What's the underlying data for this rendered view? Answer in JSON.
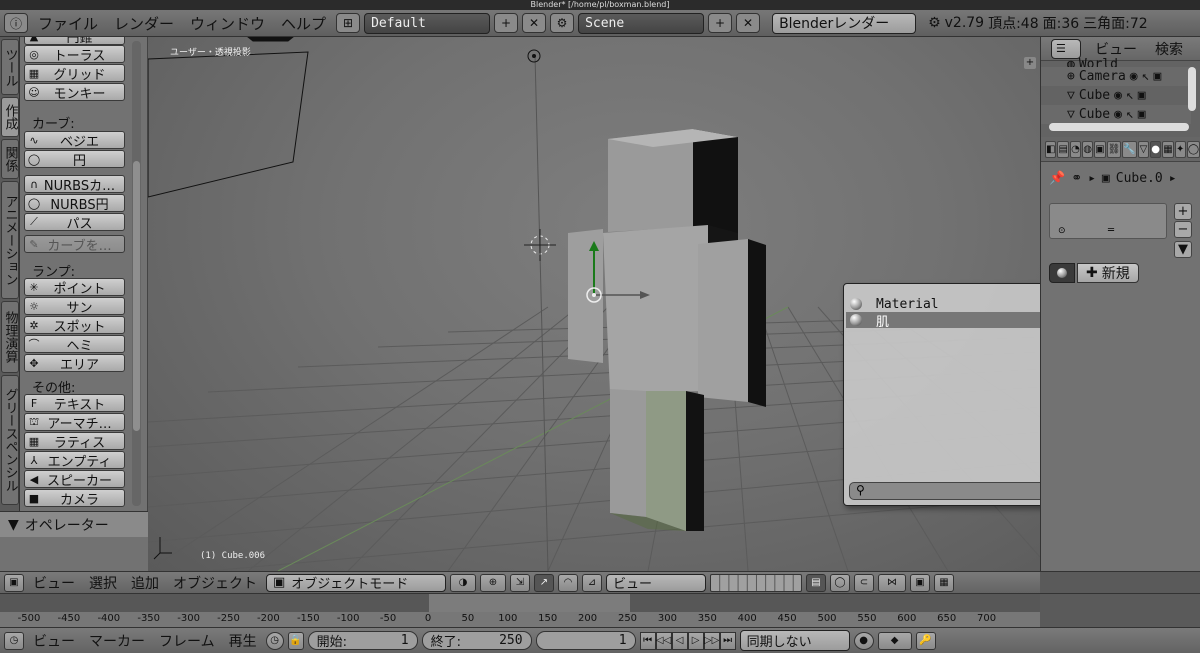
{
  "window_title": "Blender* [/home/pl/boxman.blend]",
  "info_header": {
    "menus": [
      "ファイル",
      "レンダー",
      "ウィンドウ",
      "ヘルプ"
    ],
    "screen_layout": "Default",
    "scene": "Scene",
    "render_engine": "Blenderレンダー",
    "version": "v2.79",
    "verts": "頂点:48",
    "faces": "面:36",
    "tris": "三角面:72"
  },
  "tool_tabs": [
    "ツール",
    "作成",
    "関係",
    "アニメーション",
    "物理演算",
    "グリースペンシル"
  ],
  "toolshelf": {
    "top_partial": "円錐",
    "items_top": [
      {
        "icon": "torus-icon",
        "glyph": "◎",
        "label": "トーラス"
      },
      {
        "icon": "grid-icon",
        "glyph": "▦",
        "label": "グリッド"
      },
      {
        "icon": "monkey-icon",
        "glyph": "☺",
        "label": "モンキー"
      }
    ],
    "curve_heading": "カーブ:",
    "curve_items": [
      {
        "icon": "bezier-icon",
        "glyph": "∿",
        "label": "ベジエ"
      },
      {
        "icon": "circle-icon",
        "glyph": "◯",
        "label": "円"
      }
    ],
    "nurbs_items": [
      {
        "icon": "nurbs-curve-icon",
        "glyph": "∩",
        "label": "NURBSカ…"
      },
      {
        "icon": "nurbs-circle-icon",
        "glyph": "◯",
        "label": "NURBS円"
      },
      {
        "icon": "path-icon",
        "glyph": "⟋",
        "label": "パス"
      }
    ],
    "curve_draw": {
      "icon": "curve-draw-icon",
      "glyph": "✎",
      "label": "カーブを…"
    },
    "lamp_heading": "ランプ:",
    "lamp_items": [
      {
        "icon": "point-lamp-icon",
        "glyph": "✳",
        "label": "ポイント"
      },
      {
        "icon": "sun-lamp-icon",
        "glyph": "☼",
        "label": "サン"
      },
      {
        "icon": "spot-lamp-icon",
        "glyph": "✲",
        "label": "スポット"
      },
      {
        "icon": "hemi-lamp-icon",
        "glyph": "⌒",
        "label": "ヘミ"
      },
      {
        "icon": "area-lamp-icon",
        "glyph": "✥",
        "label": "エリア"
      }
    ],
    "other_heading": "その他:",
    "other_items": [
      {
        "icon": "text-icon",
        "glyph": "F",
        "label": "テキスト"
      },
      {
        "icon": "armature-icon",
        "glyph": "⛫",
        "label": "アーマチ…"
      },
      {
        "icon": "lattice-icon",
        "glyph": "▦",
        "label": "ラティス"
      },
      {
        "icon": "empty-icon",
        "glyph": "⅄",
        "label": "エンプティ"
      },
      {
        "icon": "speaker-icon",
        "glyph": "◀",
        "label": "スピーカー"
      },
      {
        "icon": "camera-icon",
        "glyph": "■",
        "label": "カメラ"
      }
    ],
    "operator_panel": "オペレーター"
  },
  "viewport": {
    "view_label": "ユーザー・透視投影",
    "object_label": "(1) Cube.006"
  },
  "material_popup": {
    "items": [
      "Material",
      "肌"
    ],
    "selected_index": 1,
    "search_value": ""
  },
  "outliner": {
    "menu_view": "ビュー",
    "menu_search": "検索",
    "rows": [
      "World",
      "Camera",
      "Cube",
      "Cube"
    ]
  },
  "properties": {
    "object_name": "Cube.0",
    "new_button": "新規"
  },
  "view3d_header": {
    "menus": [
      "ビュー",
      "選択",
      "追加",
      "オブジェクト"
    ],
    "mode": "オブジェクトモード",
    "orientation": "ビュー"
  },
  "timeline": {
    "ticks": [
      "-500",
      "-450",
      "-400",
      "-350",
      "-300",
      "-250",
      "-200",
      "-150",
      "-100",
      "-50",
      "0",
      "50",
      "100",
      "150",
      "200",
      "250",
      "300",
      "350",
      "400",
      "450",
      "500",
      "550",
      "600",
      "650",
      "700"
    ]
  },
  "timeline_header": {
    "menus": [
      "ビュー",
      "マーカー",
      "フレーム",
      "再生"
    ],
    "start_label": "開始:",
    "start_value": "1",
    "end_label": "終了:",
    "end_value": "250",
    "current_frame": "1",
    "sync": "同期しない"
  }
}
